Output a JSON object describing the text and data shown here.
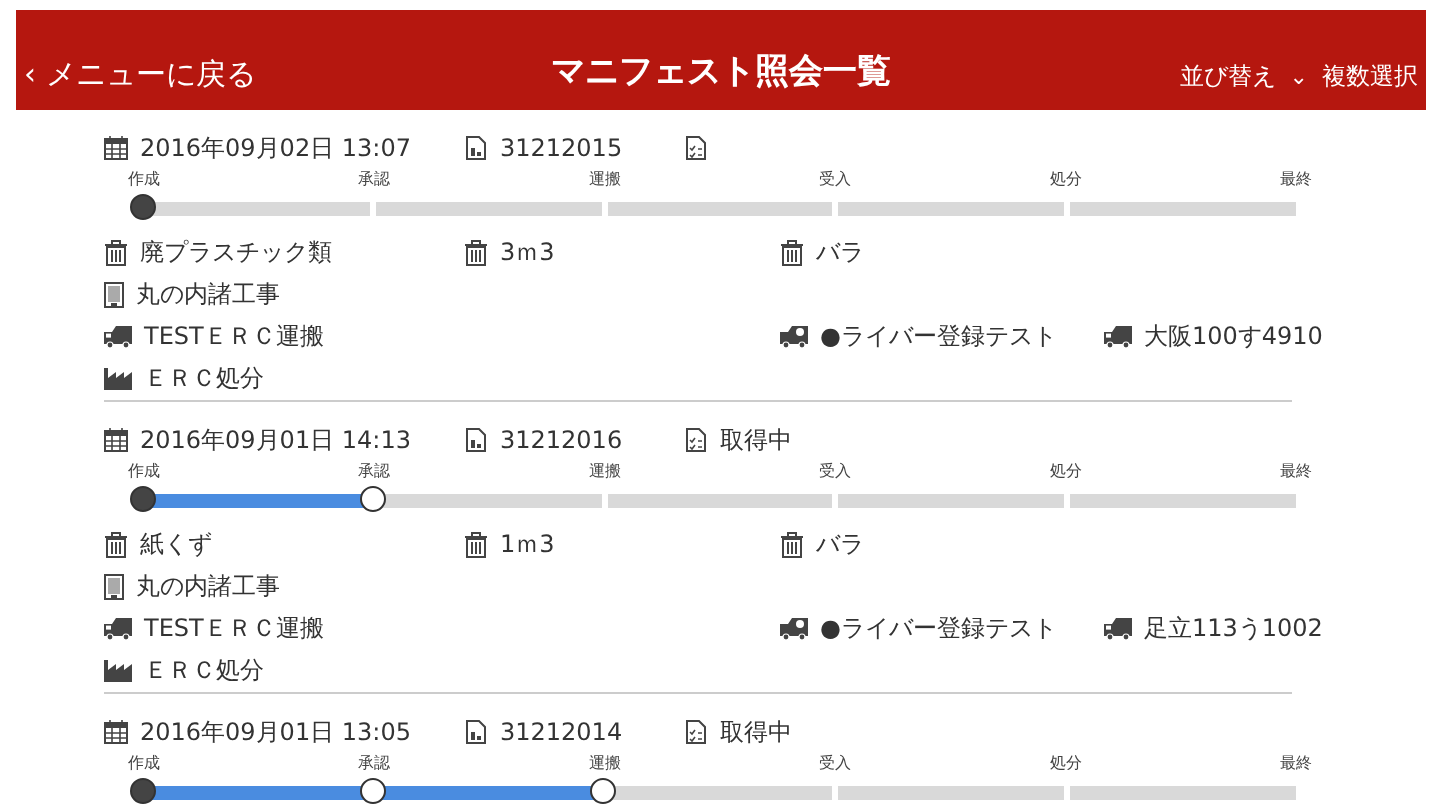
{
  "header": {
    "back": "‹ メニューに戻る",
    "title": "マニフェスト照会一覧",
    "sort": "並び替え",
    "sort_caret": "⌄",
    "multi_select": "複数選択"
  },
  "manifests": [
    {
      "date": "2016年09月02日 13:07",
      "number": "31212015",
      "stages": [
        {
          "label": "作成",
          "done": true
        },
        {
          "label": "承認",
          "done": false
        },
        {
          "label": "運搬",
          "done": false
        },
        {
          "label": "受入",
          "done": false
        },
        {
          "label": "処分",
          "done": false
        },
        {
          "label": "最終",
          "done": false
        }
      ],
      "waste": "廃プラスチック類",
      "quantity": "3ｍ3",
      "packaging": "バラ",
      "site": "丸の内諸工事",
      "transporter": "TESTＥＲＣ運搬",
      "driver": "●ライバー登録テスト",
      "vehicle": "大阪100す4910",
      "disposer": "ＥＲＣ処分"
    },
    {
      "date": "2016年09月01日 14:13",
      "number": "31212016",
      "status": "取得中",
      "stages": [
        {
          "label": "作成",
          "done": true
        },
        {
          "label": "承認",
          "done": true
        },
        {
          "label": "運搬",
          "done": false
        },
        {
          "label": "受入",
          "done": false
        },
        {
          "label": "処分",
          "done": false
        },
        {
          "label": "最終",
          "done": false
        }
      ],
      "waste": "紙くず",
      "quantity": "1ｍ3",
      "packaging": "バラ",
      "site": "丸の内諸工事",
      "transporter": "TESTＥＲＣ運搬",
      "driver": "●ライバー登録テスト",
      "vehicle": "足立113う1002",
      "disposer": "ＥＲＣ処分"
    },
    {
      "date": "2016年09月01日 13:05",
      "number": "31212014",
      "status": "取得中",
      "stages": [
        {
          "label": "作成",
          "done": true
        },
        {
          "label": "承認",
          "done": true
        },
        {
          "label": "運搬",
          "done": true
        },
        {
          "label": "受入",
          "done": false
        },
        {
          "label": "処分",
          "done": false
        },
        {
          "label": "最終",
          "done": false
        }
      ]
    }
  ]
}
